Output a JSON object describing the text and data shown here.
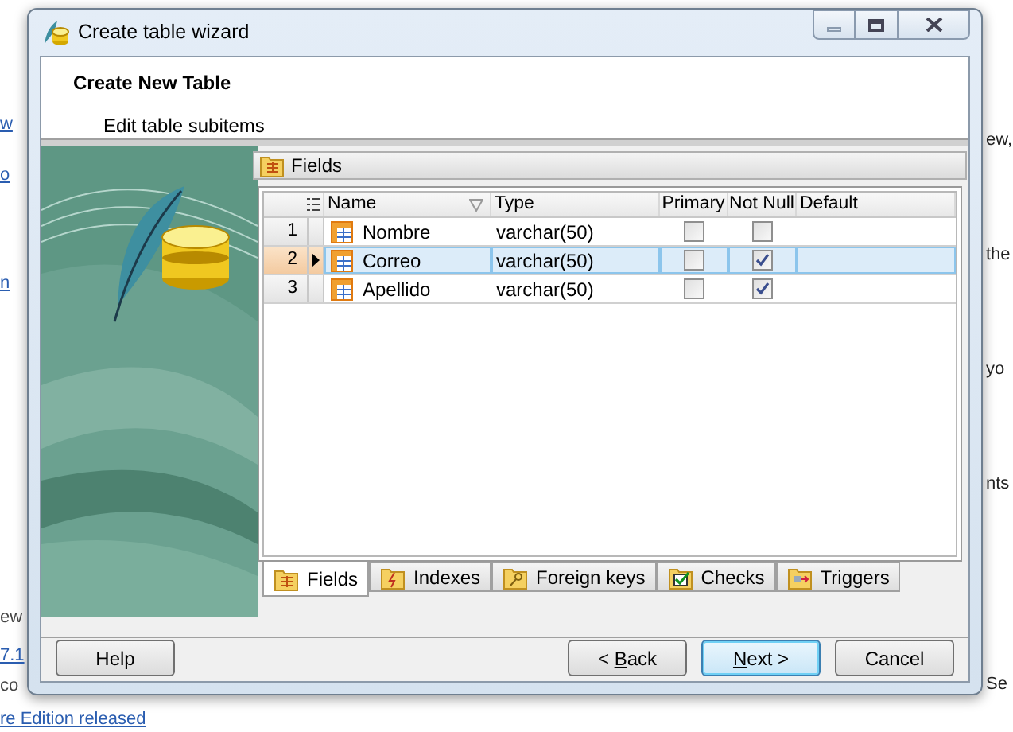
{
  "background": {
    "left": [
      {
        "text": "w",
        "link": true
      },
      {
        "text": "o",
        "link": true
      },
      {
        "text": "n",
        "link": true
      },
      {
        "text": "ew",
        "link": false
      },
      {
        "text": "7.1",
        "link": true
      },
      {
        "text": "co",
        "link": false
      },
      {
        "text": "re Edition released",
        "link": true
      }
    ],
    "right": [
      {
        "text": "ew,"
      },
      {
        "text": "the"
      },
      {
        "text": "yo"
      },
      {
        "text": "nts"
      },
      {
        "text": "Se"
      }
    ]
  },
  "window": {
    "title": "Create table wizard"
  },
  "header": {
    "title": "Create New Table",
    "subtitle": "Edit table subitems"
  },
  "panel": {
    "title": "Fields"
  },
  "table": {
    "columns": [
      "Name",
      "Type",
      "Primary",
      "Not Null",
      "Default"
    ],
    "rows": [
      {
        "number": "1",
        "name": "Nombre",
        "type": "varchar(50)",
        "primary": false,
        "not_null": false,
        "selected": false
      },
      {
        "number": "2",
        "name": "Correo",
        "type": "varchar(50)",
        "primary": false,
        "not_null": true,
        "selected": true
      },
      {
        "number": "3",
        "name": "Apellido",
        "type": "varchar(50)",
        "primary": false,
        "not_null": true,
        "selected": false
      }
    ]
  },
  "tabs": [
    {
      "label": "Fields",
      "selected": true,
      "kind": "fields"
    },
    {
      "label": "Indexes",
      "selected": false,
      "kind": "indexes"
    },
    {
      "label": "Foreign keys",
      "selected": false,
      "kind": "keys"
    },
    {
      "label": "Checks",
      "selected": false,
      "kind": "checks"
    },
    {
      "label": "Triggers",
      "selected": false,
      "kind": "triggers"
    }
  ],
  "buttons": {
    "help": "Help",
    "back": {
      "before": "< ",
      "key": "B",
      "after": "ack"
    },
    "next": {
      "key": "N",
      "after": "ext >"
    },
    "cancel": "Cancel"
  }
}
